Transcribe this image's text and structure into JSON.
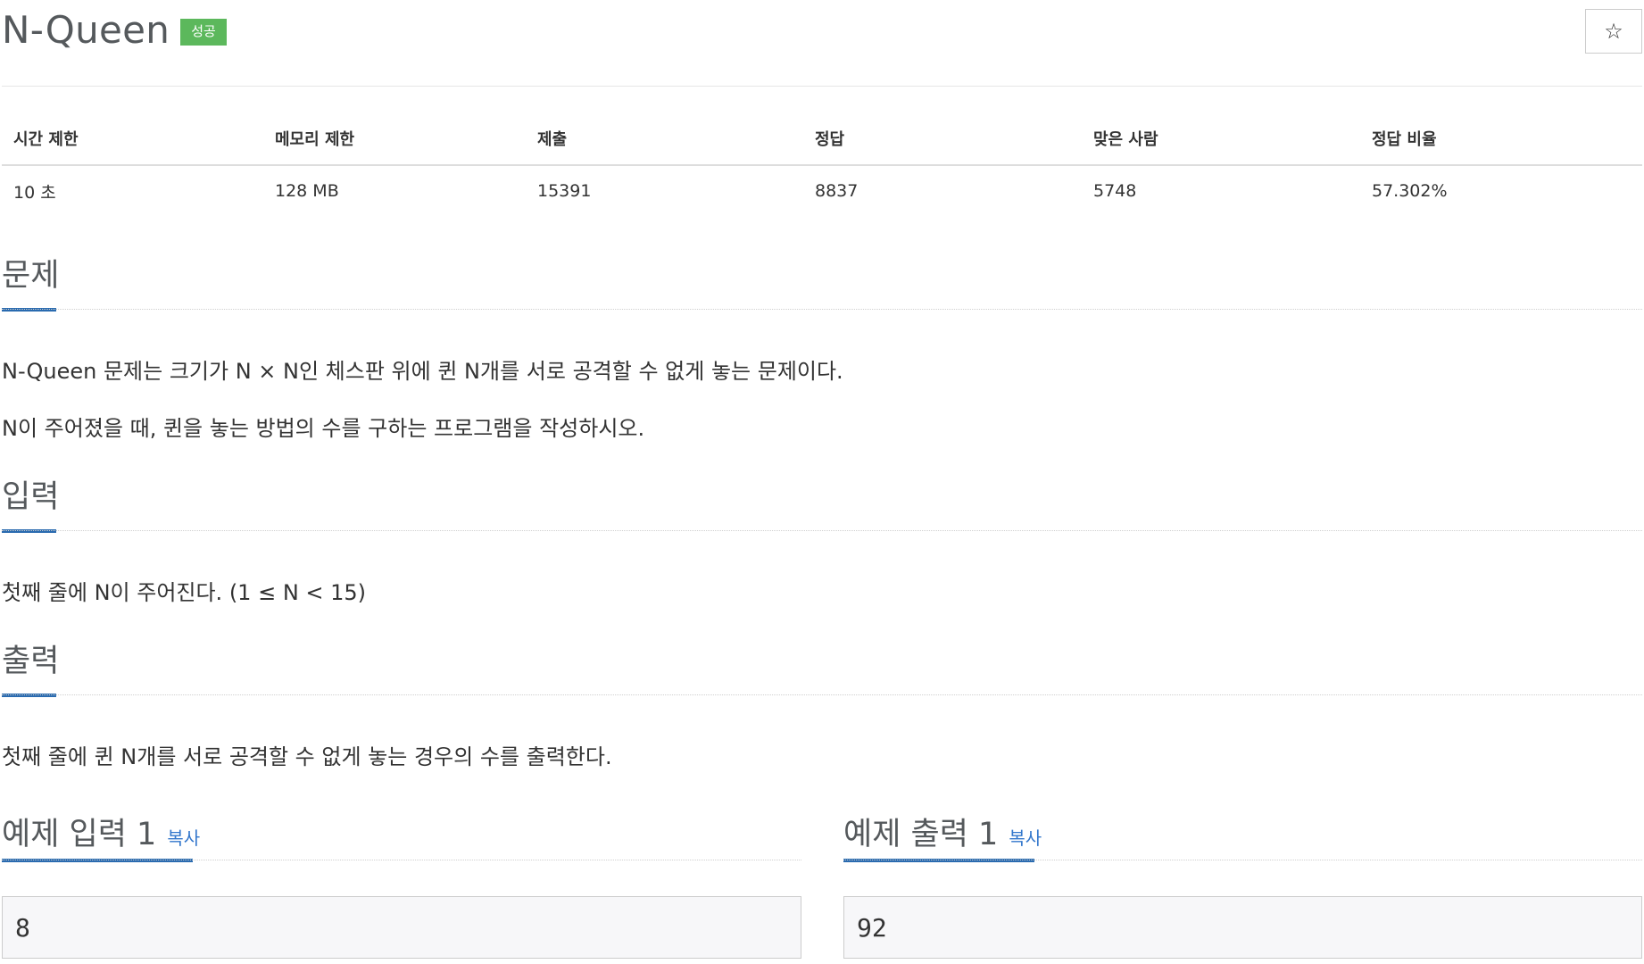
{
  "problem": {
    "title": "N-Queen",
    "status_badge": "성공",
    "star_icon": "☆"
  },
  "stats": {
    "headers": [
      "시간 제한",
      "메모리 제한",
      "제출",
      "정답",
      "맞은 사람",
      "정답 비율"
    ],
    "values": [
      "10 초",
      "128 MB",
      "15391",
      "8837",
      "5748",
      "57.302%"
    ]
  },
  "sections": {
    "problem": {
      "heading": "문제",
      "paragraphs": [
        "N-Queen 문제는 크기가 N × N인 체스판 위에 퀸 N개를 서로 공격할 수 없게 놓는 문제이다.",
        "N이 주어졌을 때, 퀸을 놓는 방법의 수를 구하는 프로그램을 작성하시오."
      ]
    },
    "input": {
      "heading": "입력",
      "text": "첫째 줄에 N이 주어진다. (1 ≤ N < 15)"
    },
    "output": {
      "heading": "출력",
      "text": "첫째 줄에 퀸 N개를 서로 공격할 수 없게 놓는 경우의 수를 출력한다."
    }
  },
  "samples": {
    "input": {
      "heading": "예제 입력 1",
      "copy_label": "복사",
      "value": "8"
    },
    "output": {
      "heading": "예제 출력 1",
      "copy_label": "복사",
      "value": "92"
    }
  },
  "colors": {
    "badge": "#5cb85c",
    "accent": "#2a6bb0",
    "link": "#3377cc"
  }
}
